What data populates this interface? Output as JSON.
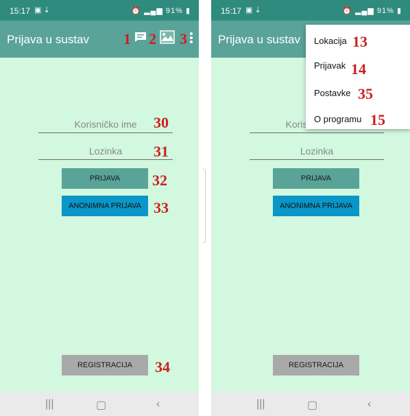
{
  "status_bar": {
    "time": "15:17",
    "battery": "91%"
  },
  "app_bar": {
    "title": "Prijava u sustav",
    "icon_labels": [
      "1",
      "2",
      "3"
    ]
  },
  "form": {
    "username_placeholder": "Korisničko ime",
    "password_placeholder": "Lozinka",
    "login_button": "PRIJAVA",
    "anonymous_login_button": "ANONIMNA PRIJAVA",
    "register_button": "REGISTRACIJA"
  },
  "annotations": {
    "username": "30",
    "password": "31",
    "login": "32",
    "anonymous_login": "33",
    "register": "34"
  },
  "overflow_menu": {
    "items": [
      {
        "label": "Lokacija",
        "number": "13"
      },
      {
        "label": "Prijavak",
        "number": "14"
      },
      {
        "label": "Postavke",
        "number": "35"
      },
      {
        "label": "O programu",
        "number": "15"
      }
    ]
  },
  "colors": {
    "status_bar": "#2f8b7d",
    "app_bar": "#5aa399",
    "background": "#d2f8df",
    "login_button": "#5aa399",
    "anonymous_button": "#0a96c8",
    "register_button": "#a9a9a9",
    "annotation": "#cc1f1f"
  },
  "nav_icons": [
    "recent-apps-icon",
    "home-icon",
    "back-icon"
  ]
}
